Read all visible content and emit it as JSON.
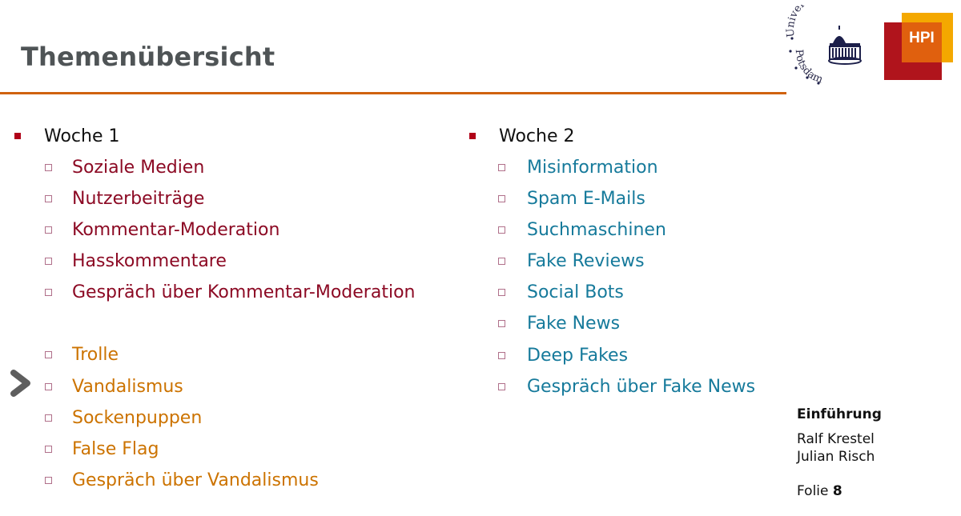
{
  "slide": {
    "title": "Themenübersicht",
    "accent_color": "#d0620f"
  },
  "logos": {
    "university": {
      "arc_top": "Universität",
      "arc_bottom": "Potsdam"
    },
    "hpi": {
      "label": "HPI"
    }
  },
  "weeks": [
    {
      "label": "Woche 1",
      "groups": [
        {
          "color": "#8c0a24",
          "items": [
            "Soziale Medien",
            "Nutzerbeiträge",
            "Kommentar-Moderation",
            "Hasskommentare",
            "Gespräch über Kommentar-Moderation"
          ]
        },
        {
          "color": "#cc7300",
          "items": [
            "Trolle",
            "Vandalismus",
            "Sockenpuppen",
            "False Flag",
            "Gespräch über Vandalismus"
          ]
        }
      ]
    },
    {
      "label": "Woche 2",
      "groups": [
        {
          "color": "#167a9b",
          "items": [
            "Misinformation",
            "Spam E-Mails",
            "Suchmaschinen",
            "Fake Reviews",
            "Social Bots",
            "Fake News",
            "Deep Fakes",
            "Gespräch über Fake News"
          ]
        }
      ]
    }
  ],
  "navigation": {
    "next_icon": "chevron-right-icon"
  },
  "footer": {
    "course": "Einführung",
    "authors": [
      "Ralf Krestel",
      "Julian Risch"
    ],
    "slide_label": "Folie",
    "slide_number": "8"
  }
}
